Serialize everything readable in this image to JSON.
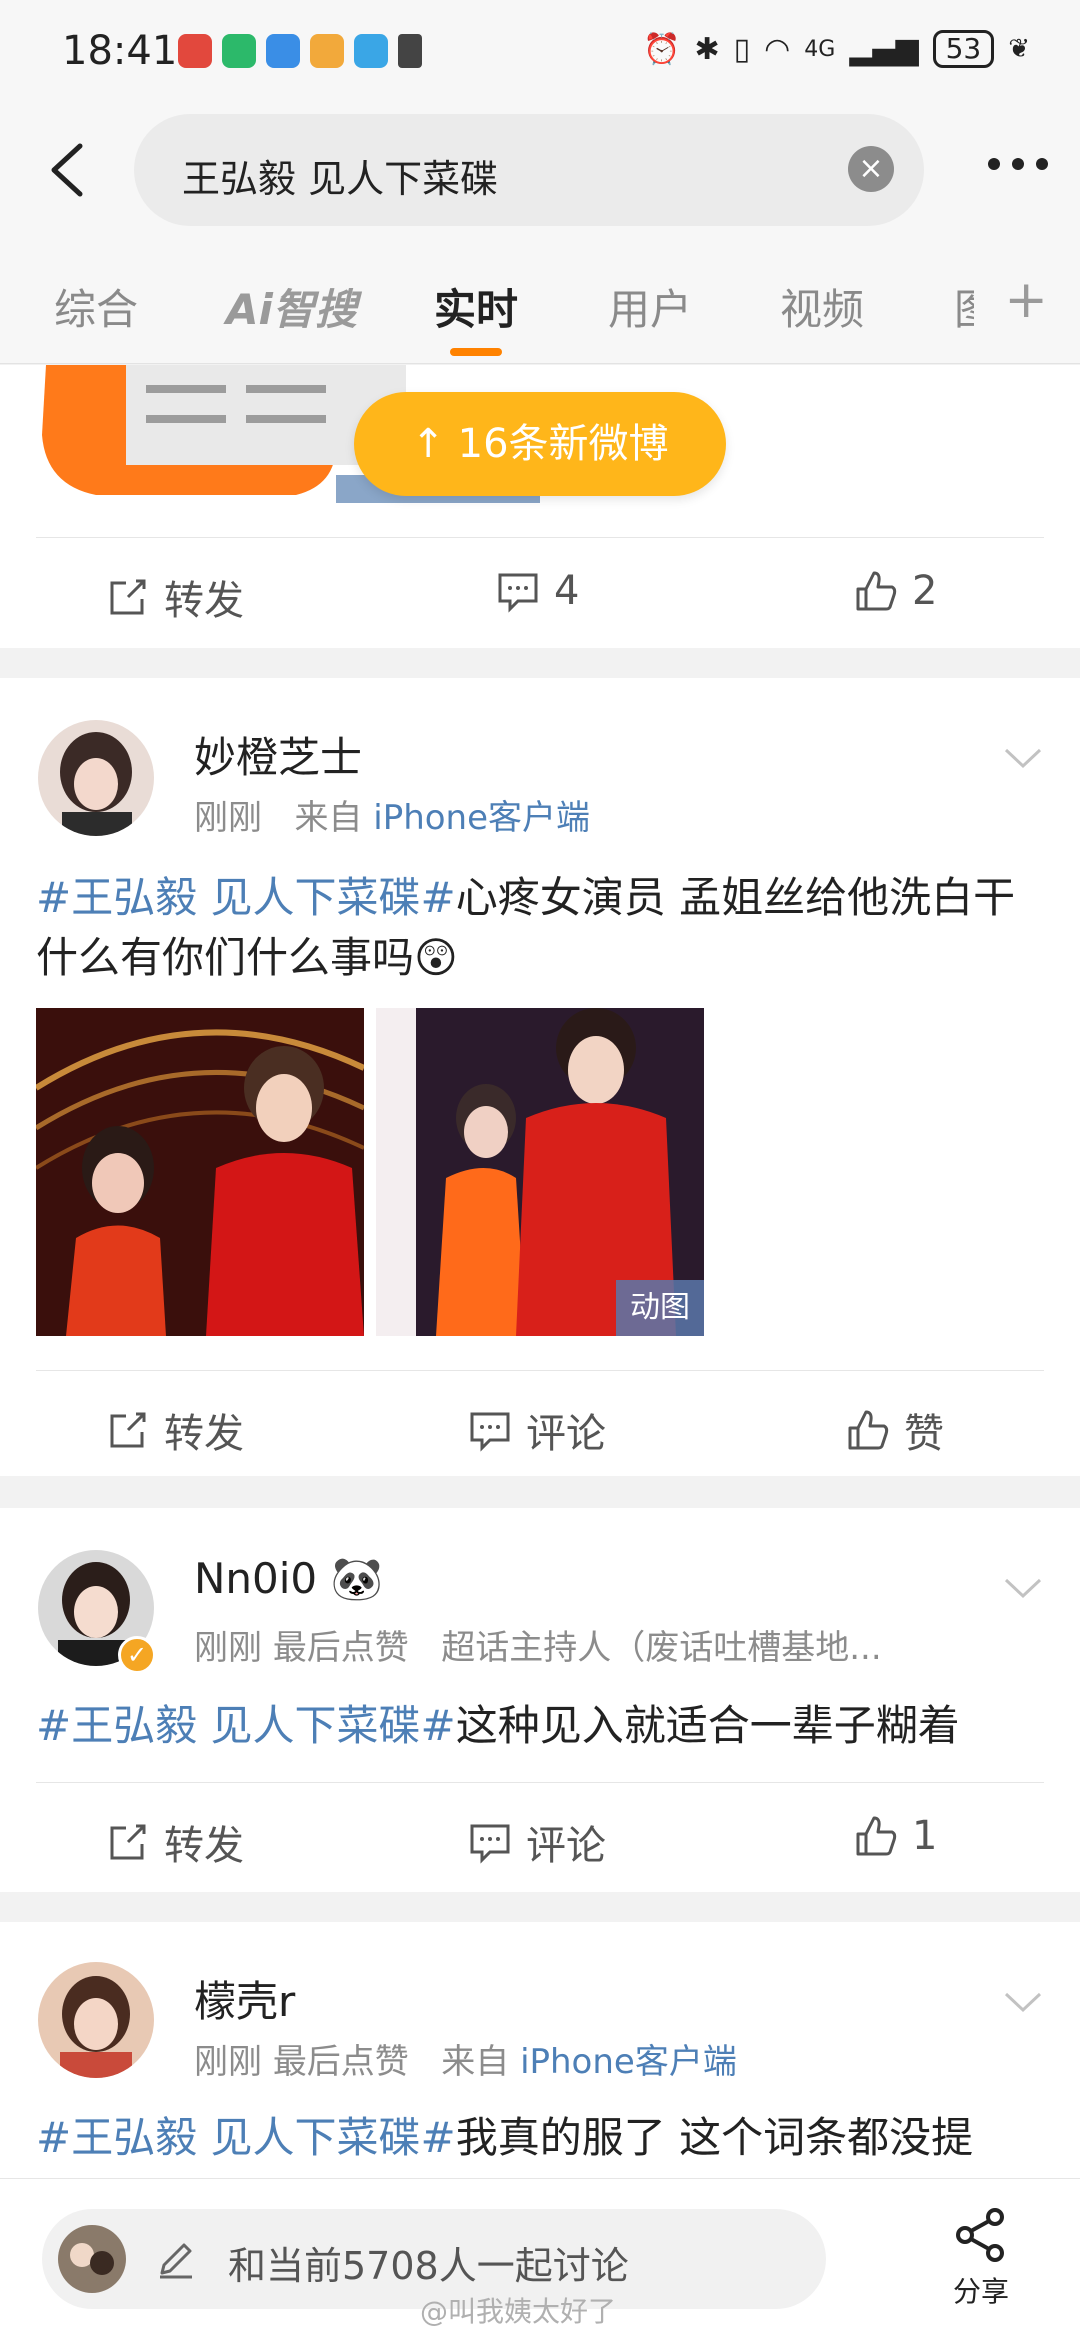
{
  "status_bar": {
    "time": "18:41",
    "network": "4G",
    "battery": "53"
  },
  "search": {
    "query": "王弘毅 见人下菜碟"
  },
  "tabs": [
    "综合",
    "Ai智搜",
    "实时",
    "用户",
    "视频",
    "图"
  ],
  "prev_post": {
    "new_posts_button": "↑ 16条新微博",
    "repost": "转发",
    "comments": "4",
    "likes": "2"
  },
  "posts": [
    {
      "user": "妙橙芝士",
      "time": "刚刚",
      "meta_extra": "来自",
      "source": "iPhone客户端",
      "tag": "#王弘毅 见人下菜碟#",
      "text": "心疼女演员 孟姐丝给他洗白干什么有你们什么事吗😲",
      "image_badge": "动图",
      "repost": "转发",
      "comment": "评论",
      "like": "赞"
    },
    {
      "user": "Nn0i0 🐼",
      "time": "刚刚",
      "meta_extra": "最后点赞",
      "source_plain": "超话主持人（废话吐槽基地...",
      "tag": "#王弘毅 见人下菜碟#",
      "text": "这种见入就适合一辈子糊着",
      "repost": "转发",
      "comment": "评论",
      "like": "1"
    },
    {
      "user": "檬壳r",
      "time": "刚刚",
      "meta_extra": "最后点赞",
      "meta_from": "来自",
      "source": "iPhone客户端",
      "tag": "#王弘毅 见人下菜碟#",
      "text": "我真的服了 这个词条都没提"
    }
  ],
  "bottom_bar": {
    "discuss_placeholder": "和当前5708人一起讨论",
    "share": "分享",
    "watermark": "@叫我姨太好了"
  }
}
